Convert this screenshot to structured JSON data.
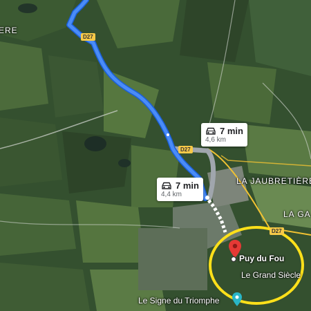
{
  "map": {
    "place_labels": {
      "left_edge": "ERE",
      "jaubretiere": "LA JAUBRETIÈRE",
      "la_ga": "LA GA"
    },
    "road_shields": {
      "d27_north": "D27",
      "d27_middle": "D27",
      "d27_east": "D27"
    },
    "routes": [
      {
        "time": "7 min",
        "distance": "4,6 km",
        "icon": "car-icon"
      },
      {
        "time": "7 min",
        "distance": "4,4 km",
        "icon": "car-icon"
      }
    ],
    "pois": {
      "puy_du_fou": "Puy du Fou",
      "grand_siecle": "Le Grand Siècle",
      "signe_triomphe": "Le Signe du Triomphe"
    },
    "colors": {
      "route_primary": "#4a8cf7",
      "route_alternate": "#a0a6ad",
      "highlight_circle": "#ffe01a",
      "destination_pin": "#e53935"
    }
  }
}
